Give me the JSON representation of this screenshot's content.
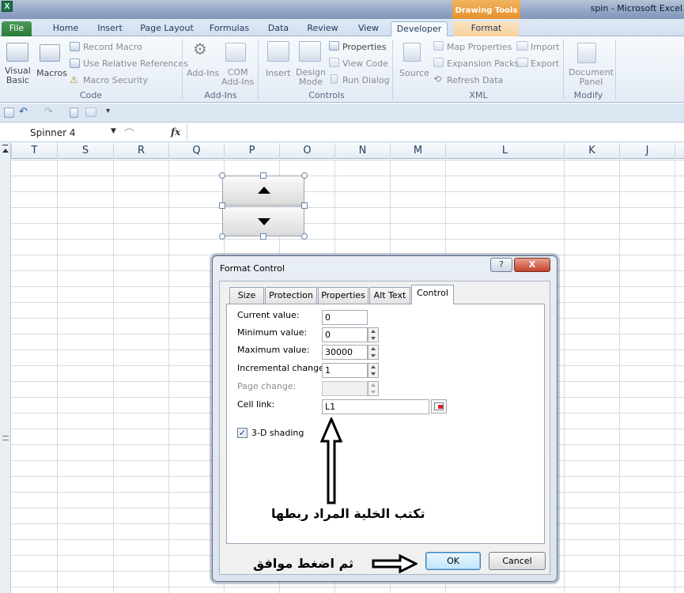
{
  "window": {
    "title": "spin - Microsoft Excel",
    "contextual_tab_group": "Drawing Tools"
  },
  "tabs": [
    {
      "label": "File"
    },
    {
      "label": "Home"
    },
    {
      "label": "Insert"
    },
    {
      "label": "Page Layout"
    },
    {
      "label": "Formulas"
    },
    {
      "label": "Data"
    },
    {
      "label": "Review"
    },
    {
      "label": "View"
    },
    {
      "label": "Developer"
    },
    {
      "label": "Format"
    }
  ],
  "ribbon": {
    "code": {
      "label": "Code",
      "visual_basic": "Visual\nBasic",
      "macros": "Macros",
      "record_macro": "Record Macro",
      "use_relative": "Use Relative References",
      "macro_security": "Macro Security"
    },
    "addins": {
      "label": "Add-Ins",
      "addins": "Add-Ins",
      "com_addins": "COM\nAdd-Ins"
    },
    "controls": {
      "label": "Controls",
      "insert": "Insert",
      "design_mode": "Design\nMode",
      "properties": "Properties",
      "view_code": "View Code",
      "run_dialog": "Run Dialog"
    },
    "xml": {
      "label": "XML",
      "source": "Source",
      "map_properties": "Map Properties",
      "expansion_packs": "Expansion Packs",
      "refresh_data": "Refresh Data",
      "import": "Import",
      "export": "Export"
    },
    "modify": {
      "label": "Modify",
      "document_panel": "Document\nPanel"
    }
  },
  "formula_bar": {
    "name_box": "Spinner 4",
    "fx": "fx",
    "content": ""
  },
  "columns": [
    "T",
    "S",
    "R",
    "Q",
    "P",
    "O",
    "N",
    "M",
    "L",
    "K",
    "J"
  ],
  "dialog": {
    "title": "Format Control",
    "help": "?",
    "close": "X",
    "tabs": [
      "Size",
      "Protection",
      "Properties",
      "Alt Text",
      "Control"
    ],
    "fields": {
      "current_value": {
        "label": "Current value:",
        "value": "0"
      },
      "minimum_value": {
        "label": "Minimum value:",
        "value": "0"
      },
      "maximum_value": {
        "label": "Maximum value:",
        "value": "30000"
      },
      "incremental_change": {
        "label": "Incremental change:",
        "value": "1"
      },
      "page_change": {
        "label": "Page change:",
        "value": ""
      },
      "cell_link": {
        "label": "Cell link:",
        "value": "L1"
      }
    },
    "shading": {
      "label": "3-D shading",
      "checked": true
    },
    "ok": "OK",
    "cancel": "Cancel"
  },
  "annotations": {
    "write_cell": "تكتب الخلية المراد ربطها",
    "press_ok": "ثم اضغط موافق"
  },
  "colors": {
    "file_tab": "#2b7a38",
    "drawing_tools": "#e7922b",
    "close_button": "#c2432e"
  }
}
